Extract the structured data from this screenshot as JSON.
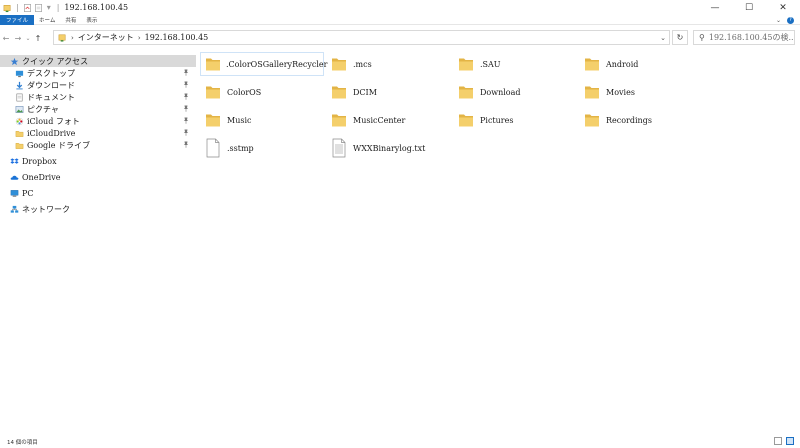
{
  "window": {
    "title": "192.168.100.45",
    "minimize_glyph": "—",
    "maximize_glyph": "☐",
    "close_glyph": "✕",
    "qa_dropdown_glyph": "▾",
    "qa_separator": "|"
  },
  "ribbon": {
    "tabs": [
      "ファイル",
      "ホーム",
      "共有",
      "表示"
    ],
    "expand_glyph": "⌄",
    "help_glyph": "?"
  },
  "nav": {
    "back_glyph": "←",
    "forward_glyph": "→",
    "recent_glyph": "⌄",
    "up_glyph": "↑"
  },
  "address": {
    "crumbs": [
      "インターネット",
      "192.168.100.45"
    ],
    "separator": "›",
    "dropdown_glyph": "⌄",
    "refresh_glyph": "↻"
  },
  "search": {
    "icon_glyph": "⚲",
    "placeholder": "192.168.100.45の検..."
  },
  "sidebar": {
    "pin_glyph": "📌",
    "items": [
      {
        "label": "クイック アクセス",
        "icon": "star-icon",
        "selected": true,
        "pinned": false,
        "indent": 1
      },
      {
        "label": "デスクトップ",
        "icon": "desktop-icon",
        "selected": false,
        "pinned": true,
        "indent": 2
      },
      {
        "label": "ダウンロード",
        "icon": "download-icon",
        "selected": false,
        "pinned": true,
        "indent": 2
      },
      {
        "label": "ドキュメント",
        "icon": "document-icon",
        "selected": false,
        "pinned": true,
        "indent": 2
      },
      {
        "label": "ピクチャ",
        "icon": "pictures-icon",
        "selected": false,
        "pinned": true,
        "indent": 2
      },
      {
        "label": "iCloud フォト",
        "icon": "icloud-photos-icon",
        "selected": false,
        "pinned": true,
        "indent": 2
      },
      {
        "label": "iCloudDrive",
        "icon": "folder-icon",
        "selected": false,
        "pinned": true,
        "indent": 2
      },
      {
        "label": "Google ドライブ",
        "icon": "folder-icon",
        "selected": false,
        "pinned": true,
        "indent": 2
      },
      {
        "label": "Dropbox",
        "icon": "dropbox-icon",
        "selected": false,
        "pinned": false,
        "indent": 1,
        "gap_before": true
      },
      {
        "label": "OneDrive",
        "icon": "onedrive-icon",
        "selected": false,
        "pinned": false,
        "indent": 1,
        "gap_before": true
      },
      {
        "label": "PC",
        "icon": "pc-icon",
        "selected": false,
        "pinned": false,
        "indent": 1,
        "gap_before": true
      },
      {
        "label": "ネットワーク",
        "icon": "network-icon",
        "selected": false,
        "pinned": false,
        "indent": 1,
        "gap_before": true
      }
    ]
  },
  "files": [
    {
      "name": ".ColorOSGalleryRecycler",
      "type": "folder",
      "focused": true
    },
    {
      "name": ".mcs",
      "type": "folder",
      "focused": false
    },
    {
      "name": ".SAU",
      "type": "folder",
      "focused": false
    },
    {
      "name": "Android",
      "type": "folder",
      "focused": false
    },
    {
      "name": "ColorOS",
      "type": "folder",
      "focused": false
    },
    {
      "name": "DCIM",
      "type": "folder",
      "focused": false
    },
    {
      "name": "Download",
      "type": "folder",
      "focused": false
    },
    {
      "name": "Movies",
      "type": "folder",
      "focused": false
    },
    {
      "name": "Music",
      "type": "folder",
      "focused": false
    },
    {
      "name": "MusicCenter",
      "type": "folder",
      "focused": false
    },
    {
      "name": "Pictures",
      "type": "folder",
      "focused": false
    },
    {
      "name": "Recordings",
      "type": "folder",
      "focused": false
    },
    {
      "name": ".sstmp",
      "type": "file",
      "focused": false
    },
    {
      "name": "WXXBinarylog.txt",
      "type": "text",
      "focused": false
    }
  ],
  "status": {
    "item_count": "14 個の項目"
  },
  "colors": {
    "accent": "#1a6fc3",
    "folder": "#f4cf6b",
    "folder_dark": "#e3b446",
    "selection": "#d9d9d9"
  }
}
